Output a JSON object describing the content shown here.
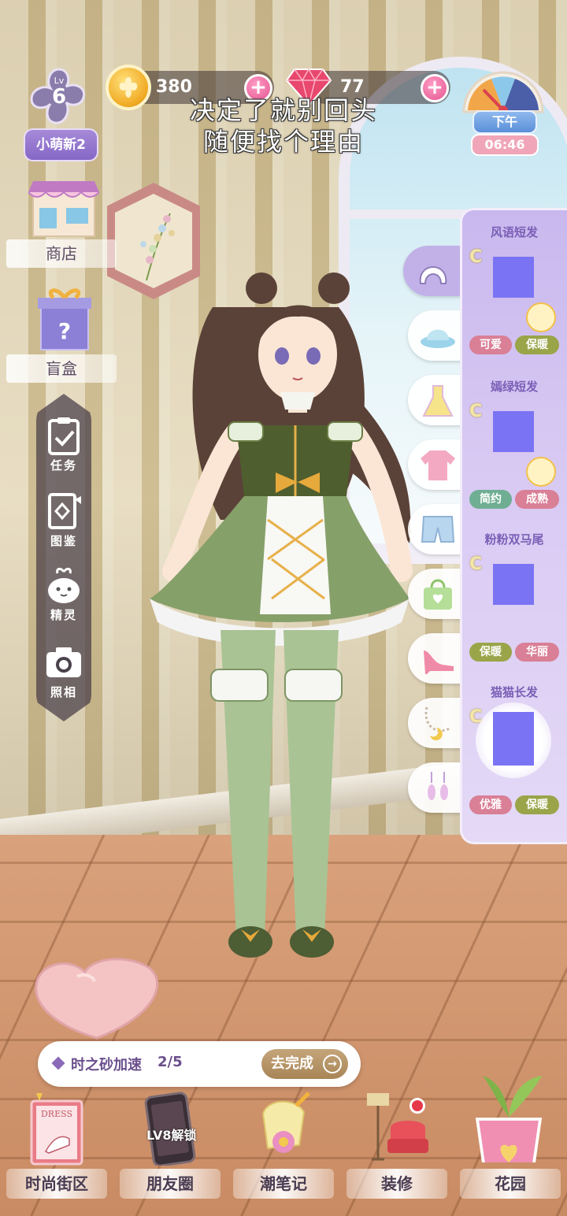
{
  "hud": {
    "level_label": "Lv",
    "level_value": "6",
    "player_name": "小萌新2",
    "coins": "380",
    "gems": "77",
    "lyrics_line1": "决定了就别回头",
    "lyrics_line2": "随便找个理由",
    "time_period": "下午",
    "time_clock": "06:46"
  },
  "left_menu": {
    "shop_label": "商店",
    "blindbox_label": "盲盒",
    "tools": [
      {
        "label": "任务",
        "icon": "clipboard-check-icon"
      },
      {
        "label": "图鉴",
        "icon": "album-icon"
      },
      {
        "label": "精灵",
        "icon": "spirit-icon"
      },
      {
        "label": "照相",
        "icon": "camera-icon"
      }
    ]
  },
  "wardrobe": {
    "categories": [
      {
        "icon": "hair-icon",
        "active": true
      },
      {
        "icon": "hat-icon",
        "active": false
      },
      {
        "icon": "dress-icon",
        "active": false
      },
      {
        "icon": "top-icon",
        "active": false
      },
      {
        "icon": "shorts-icon",
        "active": false
      },
      {
        "icon": "bag-icon",
        "active": false
      },
      {
        "icon": "shoe-icon",
        "active": false
      },
      {
        "icon": "necklace-icon",
        "active": false
      },
      {
        "icon": "earring-icon",
        "active": false
      }
    ],
    "items": [
      {
        "title": "风语短发",
        "tags": [
          "可爱",
          "保暖"
        ],
        "tag_colors": [
          "pink",
          "olive"
        ],
        "has_badge": true
      },
      {
        "title": "嫣绿短发",
        "tags": [
          "简约",
          "成熟"
        ],
        "tag_colors": [
          "teal",
          "pink"
        ],
        "has_badge": true
      },
      {
        "title": "粉粉双马尾",
        "tags": [
          "保暖",
          "华丽"
        ],
        "tag_colors": [
          "olive",
          "pink"
        ],
        "has_badge": false
      },
      {
        "title": "猫猫长发",
        "tags": [
          "优雅",
          "保暖"
        ],
        "tag_colors": [
          "pink",
          "olive"
        ],
        "has_badge": false
      }
    ],
    "currency_symbol": "C"
  },
  "task": {
    "name": "时之砂加速",
    "progress": "2/5",
    "button": "去完成"
  },
  "bottom_nav": {
    "items": [
      {
        "label": "时尚街区",
        "icon": "dress-book-icon"
      },
      {
        "label": "朋友圈",
        "icon": "phone-icon"
      },
      {
        "label": "潮笔记",
        "icon": "notebook-icon"
      },
      {
        "label": "装修",
        "icon": "furniture-icon"
      },
      {
        "label": "花园",
        "icon": "flowerpot-icon"
      }
    ],
    "lock_text": "LV8解锁",
    "book_cover_text": "DRESS"
  },
  "colors": {
    "accent_purple": "#8567c6",
    "pink": "#e3558f",
    "panel": "#d8c9f3",
    "thumb_placeholder": "#7a74f4"
  }
}
